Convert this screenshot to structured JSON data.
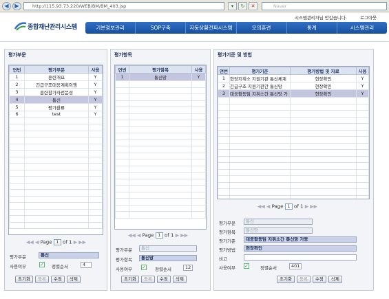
{
  "browser": {
    "url": "http://115.93.73.220/WEB/BM/BM_403.jsp",
    "search_placeholder": "Naver"
  },
  "header": {
    "brand": "종합재난관리시스템",
    "util_left": "시스템관리자님 반갑습니다.",
    "util_right": "로그아웃"
  },
  "menu": [
    "기본정보관리",
    "SOP구축",
    "자동상황전파시스템",
    "모의훈련",
    "통계",
    "시스템관리"
  ],
  "left": {
    "title": "평가부문",
    "columns": [
      "연번",
      "평가부문",
      "사용"
    ],
    "rows": [
      [
        "1",
        "훈련개요",
        "Y"
      ],
      [
        "2",
        "긴급구조대응계획이행",
        "Y"
      ],
      [
        "3",
        "훈련참가자전문성",
        "Y"
      ],
      [
        "4",
        "통신",
        "Y"
      ],
      [
        "5",
        "평가환류",
        "Y"
      ],
      [
        "6",
        "test",
        "Y"
      ]
    ],
    "selected_row": 3,
    "pager": {
      "label": "Page",
      "page": "1",
      "of": "of 1"
    },
    "form": {
      "field_label": "평가부문",
      "field_value": "통신",
      "use_label": "사용여부",
      "order_label": "정렬순서",
      "order_value": "4"
    },
    "buttons": [
      "초기화",
      "등록",
      "수정",
      "삭제"
    ]
  },
  "mid": {
    "title": "평가항목",
    "columns": [
      "연번",
      "평가항목",
      "사용"
    ],
    "rows": [
      [
        "1",
        "통신망",
        "Y"
      ]
    ],
    "selected_row": 0,
    "pager": {
      "label": "Page",
      "page": "1",
      "of": "of 1"
    },
    "form": {
      "cat_label": "평가부문",
      "cat_value": "통신",
      "item_label": "평가항목",
      "item_value": "통신망",
      "use_label": "사용여부",
      "order_label": "정렬순서",
      "order_value": "12"
    },
    "buttons": [
      "초기화",
      "등록",
      "수정",
      "삭제"
    ]
  },
  "right": {
    "title": "평가기준 및 방법",
    "columns": [
      "연번",
      "평가기준",
      "평가방법 및 자료",
      "사용"
    ],
    "rows": [
      [
        "1",
        "현장지휘소 지원기관 통신체계",
        "현장확인",
        "Y"
      ],
      [
        "2",
        "긴급구조 지원기관간 통신망",
        "현장확인",
        "Y"
      ],
      [
        "3",
        "대응활동팀 지휘소간 통신망 가",
        "현장확인",
        "Y"
      ]
    ],
    "selected_row": 2,
    "pager": {
      "label": "Page",
      "page": "1",
      "of": "of 1"
    },
    "form": {
      "cat_label": "평가부문",
      "cat_value": "통신",
      "item_label": "평가항목",
      "item_value": "통신망",
      "crit_label": "평가기준",
      "crit_value": "대응활동팀 지휘소간 통신망 가동",
      "method_label": "평가방법",
      "method_value": "현장확인",
      "note_label": "비고",
      "note_value": "",
      "use_label": "사용여부",
      "order_label": "정렬순서",
      "order_value": "401"
    },
    "buttons": [
      "초기화",
      "등록",
      "수정",
      "삭제"
    ]
  }
}
